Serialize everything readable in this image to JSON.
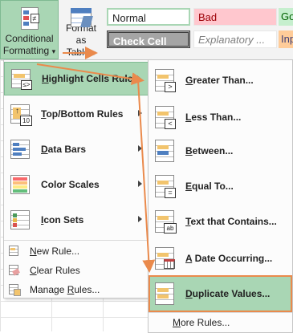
{
  "ribbon": {
    "conditional_formatting": {
      "line1": "Conditional",
      "line2": "Formatting",
      "dropdown": "▾"
    },
    "format_as_table": {
      "line1": "Format as",
      "line2": "Table",
      "dropdown": "▾"
    },
    "styles": [
      {
        "label": "Normal"
      },
      {
        "label": "Bad"
      },
      {
        "label": "Go"
      },
      {
        "label": "Check Cell"
      },
      {
        "label": "Explanatory ..."
      },
      {
        "label": "Inp"
      }
    ]
  },
  "main_menu": {
    "items": [
      {
        "pre": "",
        "key": "H",
        "post": "ighlight Cells Rules",
        "has_submenu": true
      },
      {
        "pre": "",
        "key": "T",
        "post": "op/Bottom Rules",
        "has_submenu": true
      },
      {
        "pre": "",
        "key": "D",
        "post": "ata Bars",
        "has_submenu": true
      },
      {
        "pre": "",
        "key": "S",
        "post": "Color Scales",
        "has_submenu": true
      },
      {
        "pre": "",
        "key": "I",
        "post": "con Sets",
        "has_submenu": true
      }
    ],
    "small_items": [
      {
        "pre": "",
        "key": "N",
        "post": "ew Rule..."
      },
      {
        "pre": "",
        "key": "C",
        "post": "lear Rules",
        "has_submenu": true
      },
      {
        "pre": "Manage ",
        "key": "R",
        "post": "ules..."
      }
    ],
    "top_bottom_icon_text": "10"
  },
  "sub_menu": {
    "items": [
      {
        "pre": "",
        "key": "G",
        "post": "reater Than..."
      },
      {
        "pre": "",
        "key": "L",
        "post": "ess Than..."
      },
      {
        "pre": "",
        "key": "B",
        "post": "etween..."
      },
      {
        "pre": "",
        "key": "E",
        "post": "qual To..."
      },
      {
        "pre": "",
        "key": "T",
        "post": "ext that Contains..."
      },
      {
        "pre": "",
        "key": "A",
        "post": " Date Occurring..."
      },
      {
        "pre": "",
        "key": "D",
        "post": "uplicate Values..."
      }
    ],
    "more": {
      "pre": "",
      "key": "M",
      "post": "ore Rules..."
    },
    "icon_symbols": {
      "greater": ">",
      "less": "<",
      "equal": "=",
      "text": "ab"
    }
  },
  "colors": {
    "accent_green": "#a9d6b4",
    "arrow_orange": "#ea8a4c",
    "bad_fill": "#ffc7ce",
    "good_fill": "#c6efce",
    "input_fill": "#ffcc99",
    "check_fill": "#a5a5a5"
  }
}
